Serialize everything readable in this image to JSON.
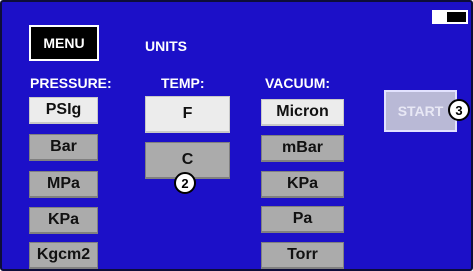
{
  "header": {
    "menu_label": "MENU",
    "title": "UNITS",
    "battery_level": 0.6
  },
  "pressure": {
    "label": "PRESSURE:",
    "options": [
      "PSIg",
      "Bar",
      "MPa",
      "KPa",
      "Kgcm2"
    ],
    "selected": "PSIg"
  },
  "temp": {
    "label": "TEMP:",
    "options": [
      "F",
      "C"
    ],
    "selected": "F"
  },
  "vacuum": {
    "label": "VACUUM:",
    "options": [
      "Micron",
      "mBar",
      "KPa",
      "Pa",
      "Torr"
    ],
    "selected": "Micron"
  },
  "start_label": "START",
  "callouts": [
    "2",
    "3"
  ]
}
